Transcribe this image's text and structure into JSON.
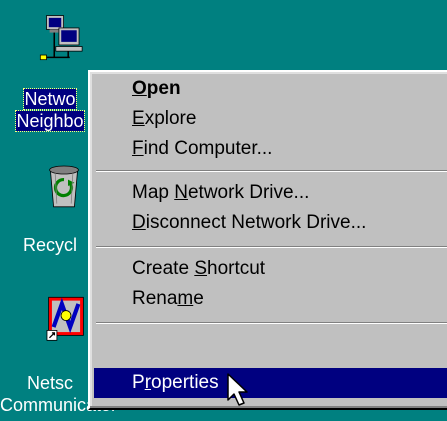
{
  "desktop": {
    "background": "#008080",
    "icons": [
      {
        "name": "network-neighborhood",
        "label_line1": "Netwo",
        "label_line2": "Neighbo",
        "icon": "network-computers-icon",
        "selected": true
      },
      {
        "name": "recycle-bin",
        "label_line1": "Recycl",
        "icon": "recycle-bin-icon",
        "selected": false
      },
      {
        "name": "netscape-communicator",
        "label_line1": "Netsc",
        "label_line2": "Communicator",
        "icon": "netscape-shortcut-icon",
        "selected": false
      }
    ]
  },
  "context_menu": {
    "items": [
      {
        "label": "Open",
        "mnemonic": "O",
        "rest": "pen",
        "default": true
      },
      {
        "label": "Explore",
        "mnemonic": "E",
        "rest": "xplore"
      },
      {
        "label": "Find Computer...",
        "mnemonic": "F",
        "rest": "ind Computer..."
      },
      {
        "label": "Map Network Drive...",
        "pre": "Map ",
        "mnemonic": "N",
        "rest": "etwork Drive..."
      },
      {
        "label": "Disconnect Network Drive...",
        "mnemonic": "D",
        "rest": "isconnect Network Drive..."
      },
      {
        "label": "Create Shortcut",
        "pre": "Create ",
        "mnemonic": "S",
        "rest": "hortcut"
      },
      {
        "label": "Rename",
        "pre": "Rena",
        "mnemonic": "m",
        "rest": "e"
      },
      {
        "label": "Properties",
        "pre": "P",
        "mnemonic": "r",
        "rest": "operties",
        "highlighted": true
      }
    ],
    "highlight_color": "#000080",
    "menu_color": "#c0c0c0"
  },
  "cursor": {
    "icon": "arrow-pointer-icon"
  }
}
